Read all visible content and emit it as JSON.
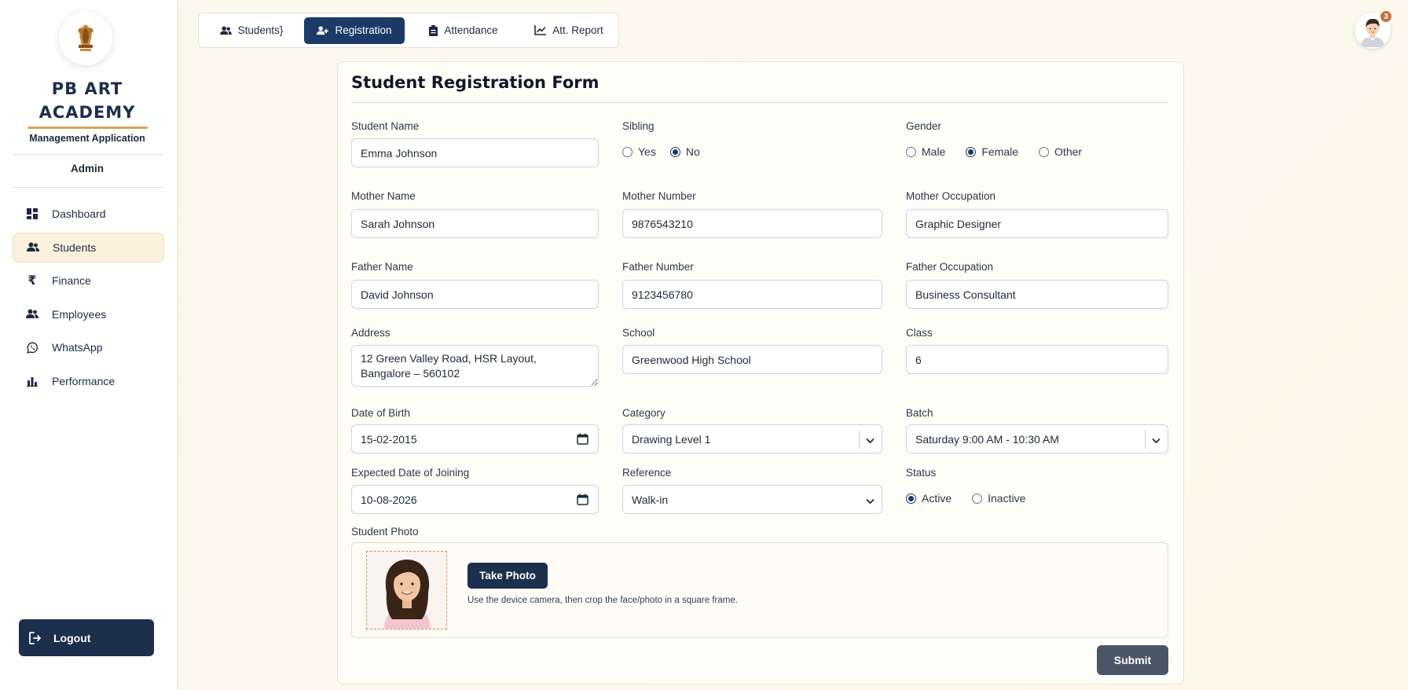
{
  "brand": {
    "title_line1": "PB ART",
    "title_line2": "ACADEMY",
    "subtitle": "Management Application",
    "role": "Admin",
    "accent_color": "#e0a05a",
    "navy_color": "#1c2f4d"
  },
  "sidebar": {
    "items": [
      {
        "label": "Dashboard",
        "icon": "dashboard-icon",
        "active": false
      },
      {
        "label": "Students",
        "icon": "users-icon",
        "active": true
      },
      {
        "label": "Finance",
        "icon": "rupee-icon",
        "active": false
      },
      {
        "label": "Employees",
        "icon": "users-icon",
        "active": false
      },
      {
        "label": "WhatsApp",
        "icon": "whatsapp-icon",
        "active": false
      },
      {
        "label": "Performance",
        "icon": "bar-chart-icon",
        "active": false
      }
    ],
    "logout_label": "Logout"
  },
  "tabs": [
    {
      "label": "Students",
      "icon": "users-icon",
      "active": false
    },
    {
      "label": "Registration",
      "icon": "user-plus-icon",
      "active": true
    },
    {
      "label": "Attendance",
      "icon": "clipboard-icon",
      "active": false
    },
    {
      "label": "Att. Report",
      "icon": "line-chart-icon",
      "active": false
    }
  ],
  "notifications": {
    "count": "3"
  },
  "form": {
    "title": "Student Registration Form",
    "student_name": {
      "label": "Student Name",
      "value": "Emma Johnson"
    },
    "sibling": {
      "label": "Sibling",
      "options": [
        "Yes",
        "No"
      ],
      "selected": "No"
    },
    "gender": {
      "label": "Gender",
      "options": [
        "Male",
        "Female",
        "Other"
      ],
      "selected": "Female"
    },
    "mother_name": {
      "label": "Mother Name",
      "value": "Sarah Johnson"
    },
    "mother_number": {
      "label": "Mother Number",
      "value": "9876543210"
    },
    "mother_occupation": {
      "label": "Mother Occupation",
      "value": "Graphic Designer"
    },
    "father_name": {
      "label": "Father Name",
      "value": "David Johnson"
    },
    "father_number": {
      "label": "Father Number",
      "value": "9123456780"
    },
    "father_occupation": {
      "label": "Father Occupation",
      "value": "Business Consultant"
    },
    "address": {
      "label": "Address",
      "value": "12 Green Valley Road, HSR Layout,\nBangalore – 560102"
    },
    "school": {
      "label": "School",
      "value": "Greenwood High School"
    },
    "class": {
      "label": "Class",
      "value": "6"
    },
    "dob": {
      "label": "Date of Birth",
      "value": "15-02-2015"
    },
    "category": {
      "label": "Category",
      "value": "Drawing Level 1"
    },
    "batch": {
      "label": "Batch",
      "value": "Saturday 9:00 AM - 10:30 AM"
    },
    "joining": {
      "label": "Expected Date of Joining",
      "value": "10-08-2026"
    },
    "reference": {
      "label": "Reference",
      "value": "Walk-in"
    },
    "status": {
      "label": "Status",
      "options": [
        "Active",
        "Inactive"
      ],
      "selected": "Active"
    },
    "photo": {
      "label": "Student Photo",
      "button": "Take Photo",
      "hint": "Use the device camera, then crop the face/photo in a square frame."
    },
    "submit": "Submit"
  }
}
